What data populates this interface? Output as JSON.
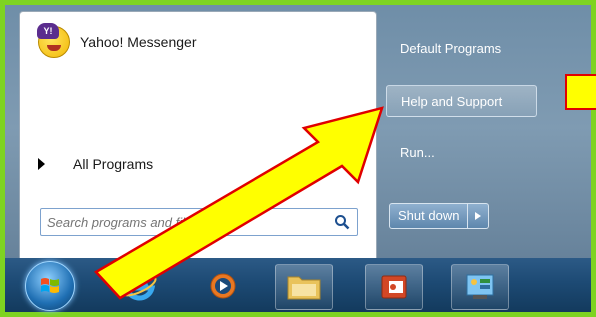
{
  "start_menu": {
    "pinned_program": "Yahoo! Messenger",
    "yahoo_icon_text": "Y!",
    "all_programs": "All Programs",
    "search": {
      "placeholder": "Search programs and files",
      "value": ""
    },
    "right_items": [
      "Default Programs",
      "Help and Support",
      "Run..."
    ],
    "shutdown_label": "Shut down"
  },
  "taskbar": {
    "buttons": [
      "internet-explorer",
      "media-player",
      "file-explorer",
      "powerpoint",
      "control-panel"
    ]
  },
  "annotations": {
    "arrow_color": "#ffff00",
    "arrow_outline": "#e00000",
    "frame_color": "#7ed321"
  }
}
